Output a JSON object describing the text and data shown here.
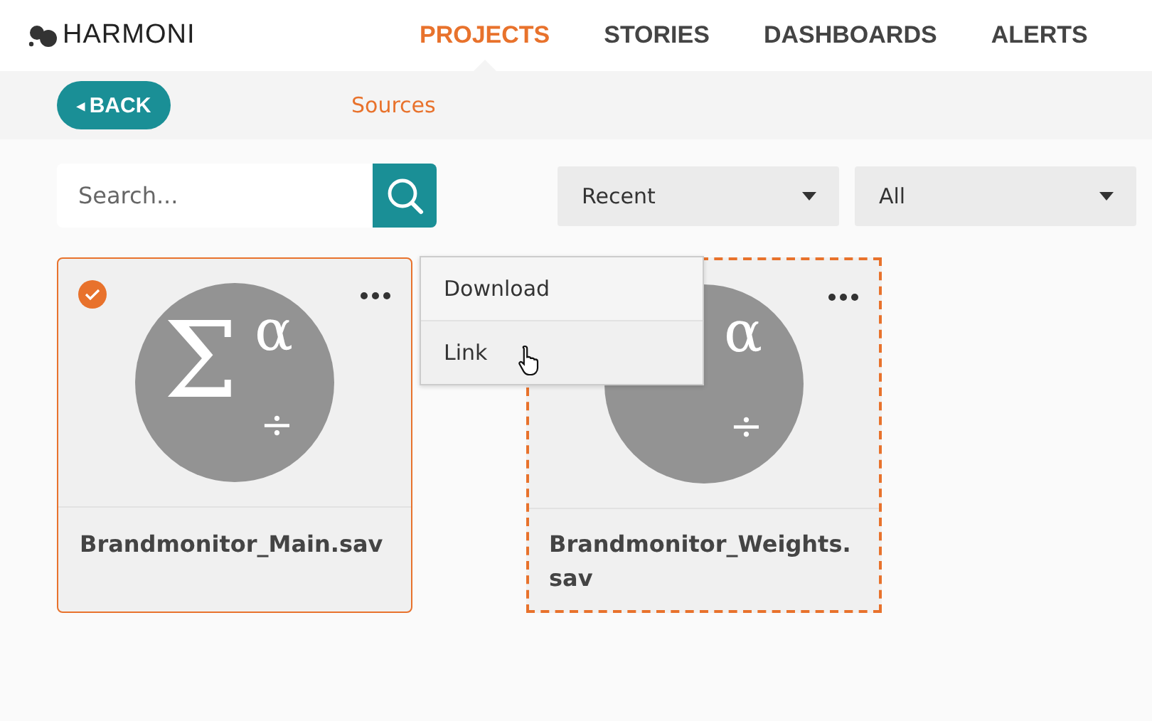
{
  "logo": {
    "text": "HARMONI"
  },
  "nav": [
    {
      "label": "PROJECTS",
      "selected": true
    },
    {
      "label": "STORIES",
      "selected": false
    },
    {
      "label": "DASHBOARDS",
      "selected": false
    },
    {
      "label": "ALERTS",
      "selected": false
    }
  ],
  "back_button": {
    "label": "BACK",
    "arrow": "◂"
  },
  "breadcrumb": "Sources",
  "search": {
    "placeholder": "Search..."
  },
  "filters": [
    {
      "value": "Recent"
    },
    {
      "value": "All"
    }
  ],
  "cards": [
    {
      "name": "Brandmonitor_Main.sav",
      "glyphs": [
        {
          "kind": "sigma",
          "text": "Σ"
        },
        {
          "kind": "alpha",
          "text": "α"
        },
        {
          "kind": "divide",
          "text": "÷"
        }
      ],
      "selected": true,
      "drop_target": false
    },
    {
      "name": "Brandmonitor_Weights.sav",
      "glyphs": [
        {
          "kind": "alpha",
          "text": "α"
        },
        {
          "kind": "divide",
          "text": "÷"
        }
      ],
      "selected": false,
      "drop_target": true
    }
  ],
  "context_menu": {
    "items": [
      {
        "label": "Download",
        "hovered": false
      },
      {
        "label": "Link",
        "hovered": true
      }
    ]
  }
}
